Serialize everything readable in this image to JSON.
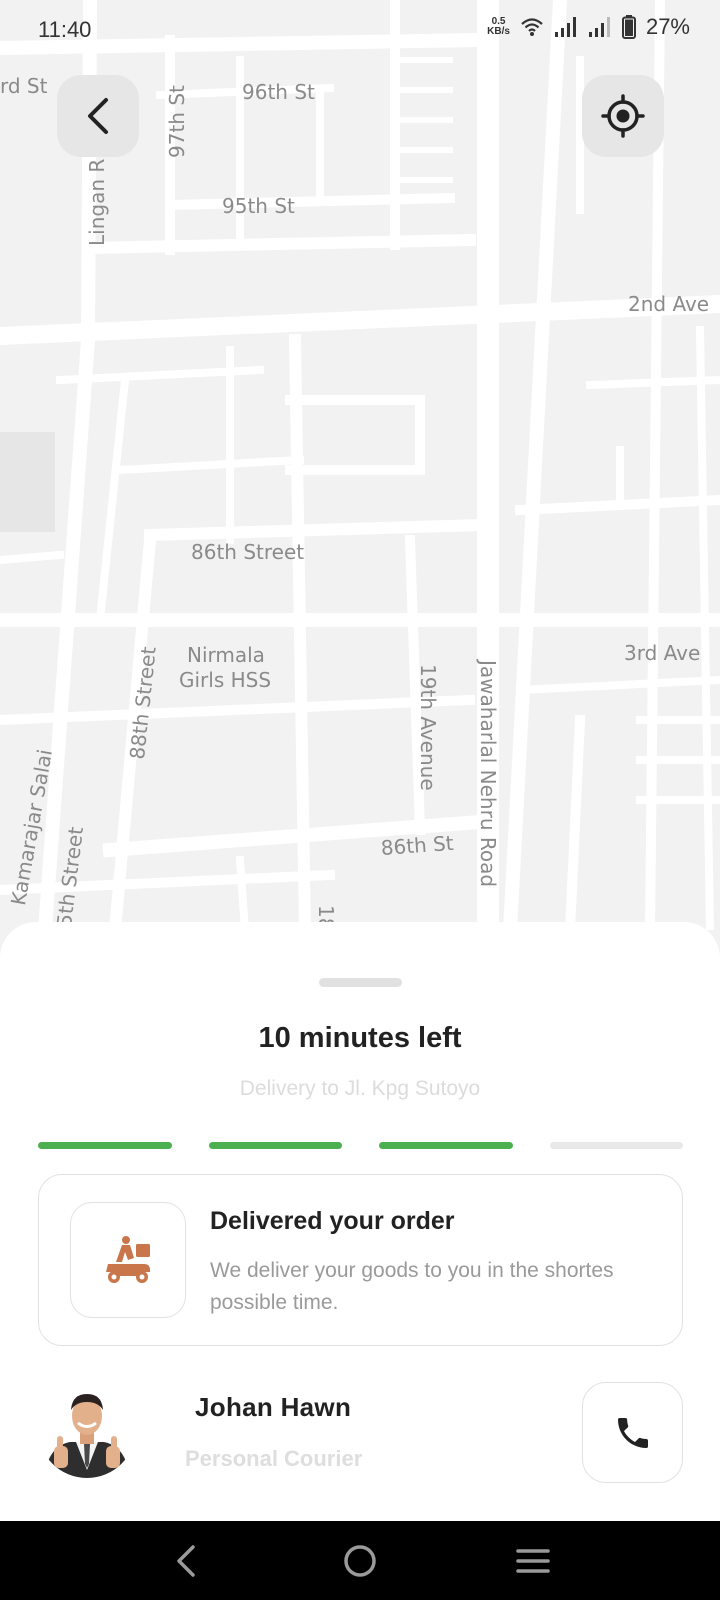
{
  "status_bar": {
    "time": "11:40",
    "net_speed_top": "0.5",
    "net_speed_unit": "KB/s",
    "battery": "27%",
    "icons": [
      "wifi-icon",
      "signal-icon",
      "signal-icon",
      "battery-icon"
    ]
  },
  "map": {
    "labels": [
      "rd St",
      "96th St",
      "97th St",
      "Lingan R",
      "95th St",
      "2nd Ave",
      "86th Street",
      "Nirmala",
      "Girls HSS",
      "3rd Ave",
      "88th Street",
      "19th Avenue",
      "Jawaharlal Nehru Road",
      "Kamarajar Salai",
      "5th Street",
      "86th St",
      "18"
    ]
  },
  "map_controls": {
    "back_icon": "chevron-left-icon",
    "locate_icon": "crosshair-icon"
  },
  "sheet": {
    "title": "10 minutes left",
    "subtitle": "Delivery to Jl. Kpg Sutoyo",
    "progress": {
      "completed_steps": 3,
      "total_steps": 4
    },
    "order": {
      "icon": "delivery-scooter-icon",
      "title": "Delivered your order",
      "description": "We deliver your goods to you in the shortes possible time."
    },
    "courier": {
      "name": "Johan Hawn",
      "role": "Personal Courier",
      "call_icon": "phone-icon"
    }
  },
  "colors": {
    "accent_green": "#4caf50",
    "scooter_orange": "#c8764a",
    "map_background": "#f2f2f2",
    "road": "#ffffff"
  }
}
